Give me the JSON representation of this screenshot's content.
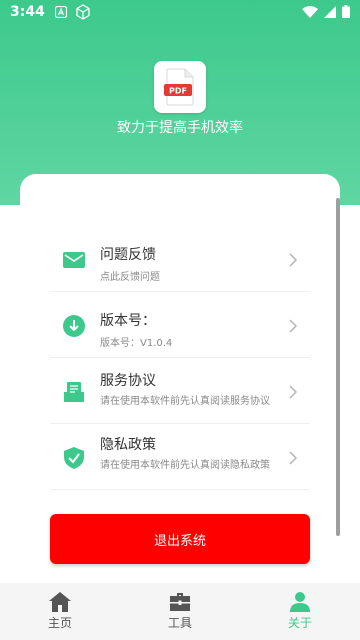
{
  "status_bar": {
    "time": "3:44"
  },
  "app": {
    "logo_text": "PDF",
    "slogan": "致力于提高手机效率"
  },
  "menu": [
    {
      "title": "问题反馈",
      "subtitle": "点此反馈问题",
      "icon": "mail-icon"
    },
    {
      "title": "版本号：",
      "subtitle": "版本号：V1.0.4",
      "icon": "download-icon"
    },
    {
      "title": "服务协议",
      "subtitle": "请在使用本软件前先认真阅读服务协议",
      "icon": "document-icon"
    },
    {
      "title": "隐私政策",
      "subtitle": "请在使用本软件前先认真阅读隐私政策",
      "icon": "shield-check-icon"
    }
  ],
  "logout_label": "退出系统",
  "bottom_nav": [
    {
      "label": "主页",
      "icon": "home-icon",
      "active": false
    },
    {
      "label": "工具",
      "icon": "toolbox-icon",
      "active": false
    },
    {
      "label": "关于",
      "icon": "person-icon",
      "active": true
    }
  ],
  "colors": {
    "accent": "#3dc98c",
    "danger": "#ff0000",
    "nav_inactive": "#555555"
  }
}
